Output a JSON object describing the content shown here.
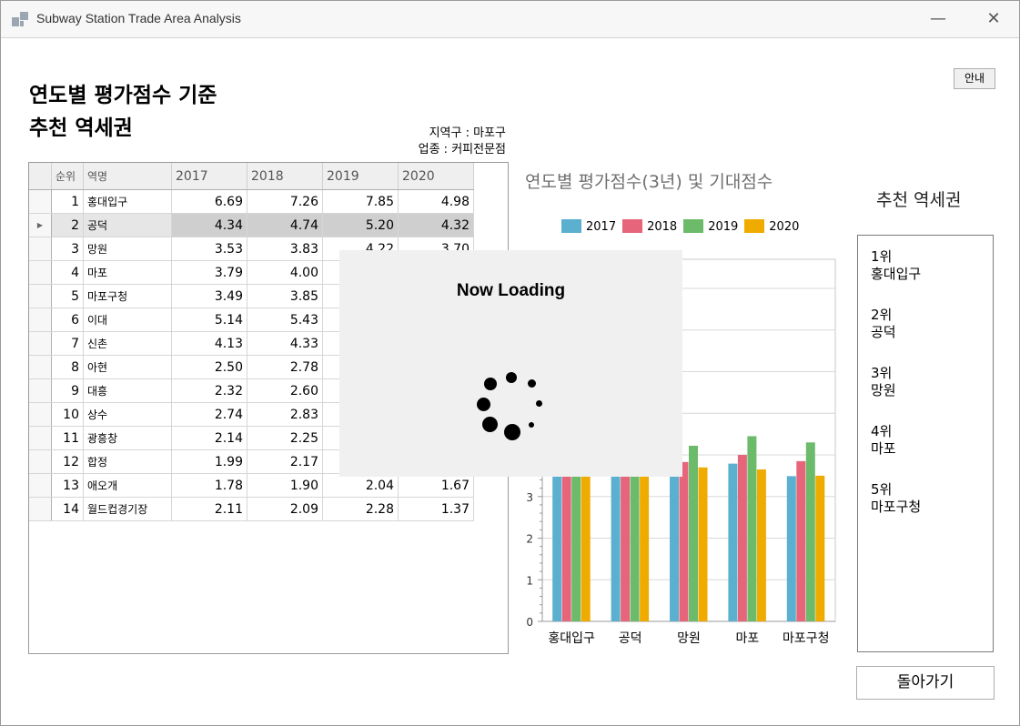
{
  "window": {
    "title": "Subway Station Trade Area Analysis",
    "minimize": "—",
    "close": "✕"
  },
  "heading": {
    "line1": "연도별 평가점수 기준",
    "line2": "추천 역세권"
  },
  "info": {
    "district": "지역구 : 마포구",
    "business": "업종 : 커피전문점"
  },
  "guide_button": "안내",
  "grid": {
    "headers": [
      "순위",
      "역명",
      "2017",
      "2018",
      "2019",
      "2020"
    ],
    "selected_row": 1,
    "rows": [
      {
        "rank": "1",
        "name": "홍대입구",
        "v2017": "6.69",
        "v2018": "7.26",
        "v2019": "7.85",
        "v2020": "4.98"
      },
      {
        "rank": "2",
        "name": "공덕",
        "v2017": "4.34",
        "v2018": "4.74",
        "v2019": "5.20",
        "v2020": "4.32"
      },
      {
        "rank": "3",
        "name": "망원",
        "v2017": "3.53",
        "v2018": "3.83",
        "v2019": "4.22",
        "v2020": "3.70"
      },
      {
        "rank": "4",
        "name": "마포",
        "v2017": "3.79",
        "v2018": "4.00",
        "v2019": "",
        "v2020": ""
      },
      {
        "rank": "5",
        "name": "마포구청",
        "v2017": "3.49",
        "v2018": "3.85",
        "v2019": "",
        "v2020": ""
      },
      {
        "rank": "6",
        "name": "이대",
        "v2017": "5.14",
        "v2018": "5.43",
        "v2019": "",
        "v2020": ""
      },
      {
        "rank": "7",
        "name": "신촌",
        "v2017": "4.13",
        "v2018": "4.33",
        "v2019": "",
        "v2020": ""
      },
      {
        "rank": "8",
        "name": "아현",
        "v2017": "2.50",
        "v2018": "2.78",
        "v2019": "",
        "v2020": ""
      },
      {
        "rank": "9",
        "name": "대흥",
        "v2017": "2.32",
        "v2018": "2.60",
        "v2019": "",
        "v2020": ""
      },
      {
        "rank": "10",
        "name": "상수",
        "v2017": "2.74",
        "v2018": "2.83",
        "v2019": "",
        "v2020": ""
      },
      {
        "rank": "11",
        "name": "광흥창",
        "v2017": "2.14",
        "v2018": "2.25",
        "v2019": "",
        "v2020": ""
      },
      {
        "rank": "12",
        "name": "합정",
        "v2017": "1.99",
        "v2018": "2.17",
        "v2019": "",
        "v2020": ""
      },
      {
        "rank": "13",
        "name": "애오개",
        "v2017": "1.78",
        "v2018": "1.90",
        "v2019": "2.04",
        "v2020": "1.67"
      },
      {
        "rank": "14",
        "name": "월드컵경기장",
        "v2017": "2.11",
        "v2018": "2.09",
        "v2019": "2.28",
        "v2020": "1.37"
      }
    ]
  },
  "loading": {
    "text": "Now Loading"
  },
  "chart_data": {
    "type": "bar",
    "title": "연도별 평가점수(3년) 및 기대점수",
    "categories": [
      "홍대입구",
      "공덕",
      "망원",
      "마포",
      "마포구청"
    ],
    "series": [
      {
        "name": "2017",
        "color": "#5bb0cf",
        "values": [
          6.69,
          4.34,
          3.53,
          3.79,
          3.49
        ]
      },
      {
        "name": "2018",
        "color": "#e6657a",
        "values": [
          7.26,
          4.74,
          3.83,
          4.0,
          3.85
        ]
      },
      {
        "name": "2019",
        "color": "#6cbb6a",
        "values": [
          7.85,
          5.2,
          4.22,
          4.45,
          4.3
        ]
      },
      {
        "name": "2020",
        "color": "#f0ab00",
        "values": [
          4.98,
          4.32,
          3.7,
          3.65,
          3.5
        ]
      }
    ],
    "y_ticks": [
      "0",
      "1",
      "2",
      "3"
    ],
    "ylim": [
      0,
      8.7
    ],
    "grid": true,
    "legend": "top"
  },
  "recommend": {
    "title": "추천 역세권",
    "items": [
      {
        "rank": "1위",
        "name": "홍대입구"
      },
      {
        "rank": "2위",
        "name": "공덕"
      },
      {
        "rank": "3위",
        "name": "망원"
      },
      {
        "rank": "4위",
        "name": "마포"
      },
      {
        "rank": "5위",
        "name": "마포구청"
      }
    ]
  },
  "back_button": "돌아가기"
}
